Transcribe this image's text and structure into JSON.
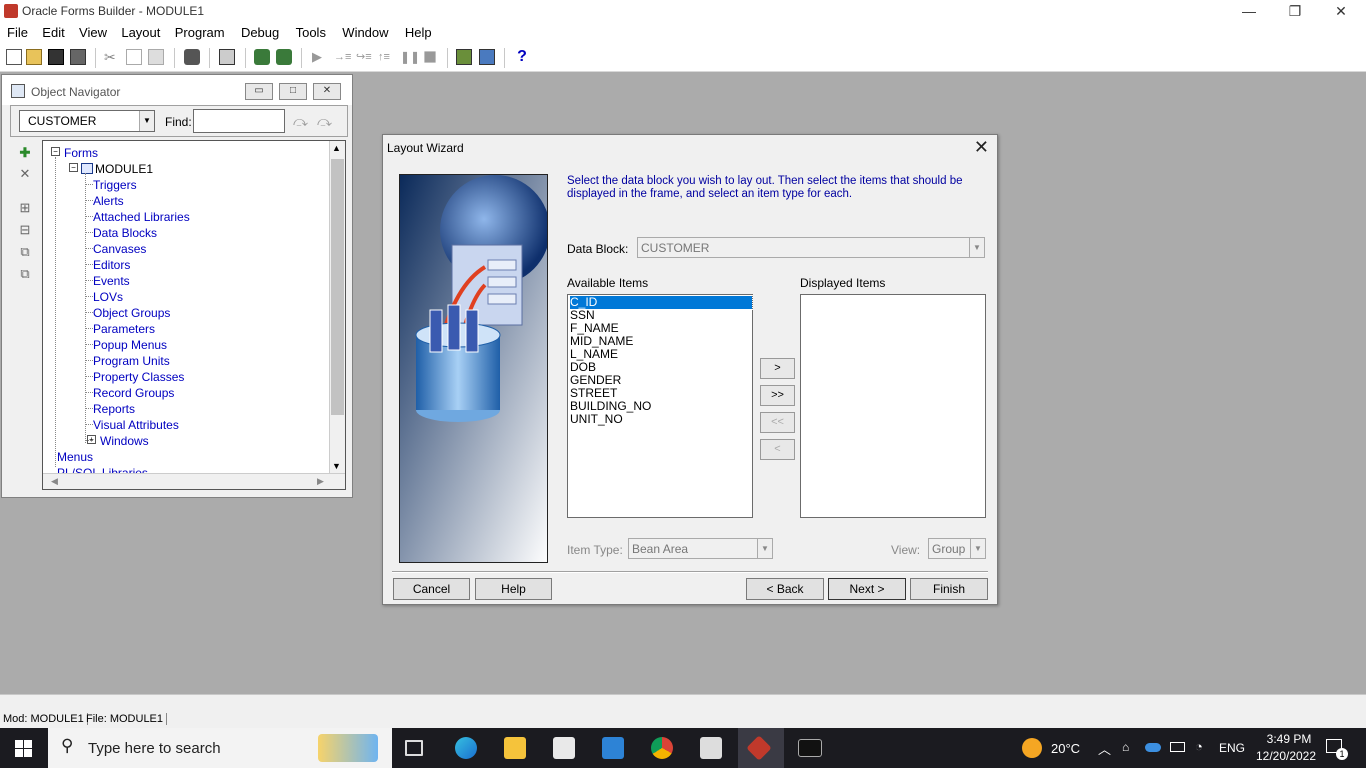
{
  "window": {
    "title": "Oracle Forms Builder - MODULE1",
    "controls": [
      "—",
      "❐",
      "✕"
    ]
  },
  "menu": [
    "File",
    "Edit",
    "View",
    "Layout",
    "Program",
    "Debug",
    "Tools",
    "Window",
    "Help"
  ],
  "navigator": {
    "title": "Object Navigator",
    "selector_value": "CUSTOMER",
    "find_label": "Find:",
    "find_value": "",
    "tree": [
      {
        "label": "Forms",
        "depth": 0,
        "expander": "−"
      },
      {
        "label": "MODULE1",
        "depth": 1,
        "expander": "−"
      },
      {
        "label": "Triggers",
        "depth": 2
      },
      {
        "label": "Alerts",
        "depth": 2
      },
      {
        "label": "Attached Libraries",
        "depth": 2
      },
      {
        "label": "Data Blocks",
        "depth": 2
      },
      {
        "label": "Canvases",
        "depth": 2
      },
      {
        "label": "Editors",
        "depth": 2
      },
      {
        "label": "Events",
        "depth": 2
      },
      {
        "label": "LOVs",
        "depth": 2
      },
      {
        "label": "Object Groups",
        "depth": 2
      },
      {
        "label": "Parameters",
        "depth": 2
      },
      {
        "label": "Popup Menus",
        "depth": 2
      },
      {
        "label": "Program Units",
        "depth": 2
      },
      {
        "label": "Property Classes",
        "depth": 2
      },
      {
        "label": "Record Groups",
        "depth": 2
      },
      {
        "label": "Reports",
        "depth": 2
      },
      {
        "label": "Visual Attributes",
        "depth": 2
      },
      {
        "label": "Windows",
        "depth": 2,
        "expander": "+"
      },
      {
        "label": "Menus",
        "depth": 0
      },
      {
        "label": "PL/SQL Libraries",
        "depth": 0
      }
    ]
  },
  "wizard": {
    "title": "Layout Wizard",
    "instructions": "Select the data block you wish to lay out. Then select the items that should be displayed in the frame, and select an item type for each.",
    "data_block_label": "Data Block:",
    "data_block_value": "CUSTOMER",
    "available_label": "Available Items",
    "displayed_label": "Displayed Items",
    "available_items": [
      "C_ID",
      "SSN",
      "F_NAME",
      "MID_NAME",
      "L_NAME",
      "DOB",
      "GENDER",
      "STREET",
      "BUILDING_NO",
      "UNIT_NO"
    ],
    "selected_item": "C_ID",
    "displayed_items": [],
    "move_buttons": [
      ">",
      ">>",
      "<<",
      "<"
    ],
    "item_type_label": "Item Type:",
    "item_type_value": "Bean Area",
    "view_label": "View:",
    "view_value": "Group",
    "buttons": {
      "cancel": "Cancel",
      "help": "Help",
      "back": "< Back",
      "next": "Next >",
      "finish": "Finish"
    }
  },
  "status": {
    "mod": "Mod: MODULE1",
    "file": "File: MODULE1"
  },
  "taskbar": {
    "search_placeholder": "Type here to search",
    "temperature": "20°C",
    "language": "ENG",
    "time": "3:49 PM",
    "date": "12/20/2022",
    "notifications": "1"
  }
}
